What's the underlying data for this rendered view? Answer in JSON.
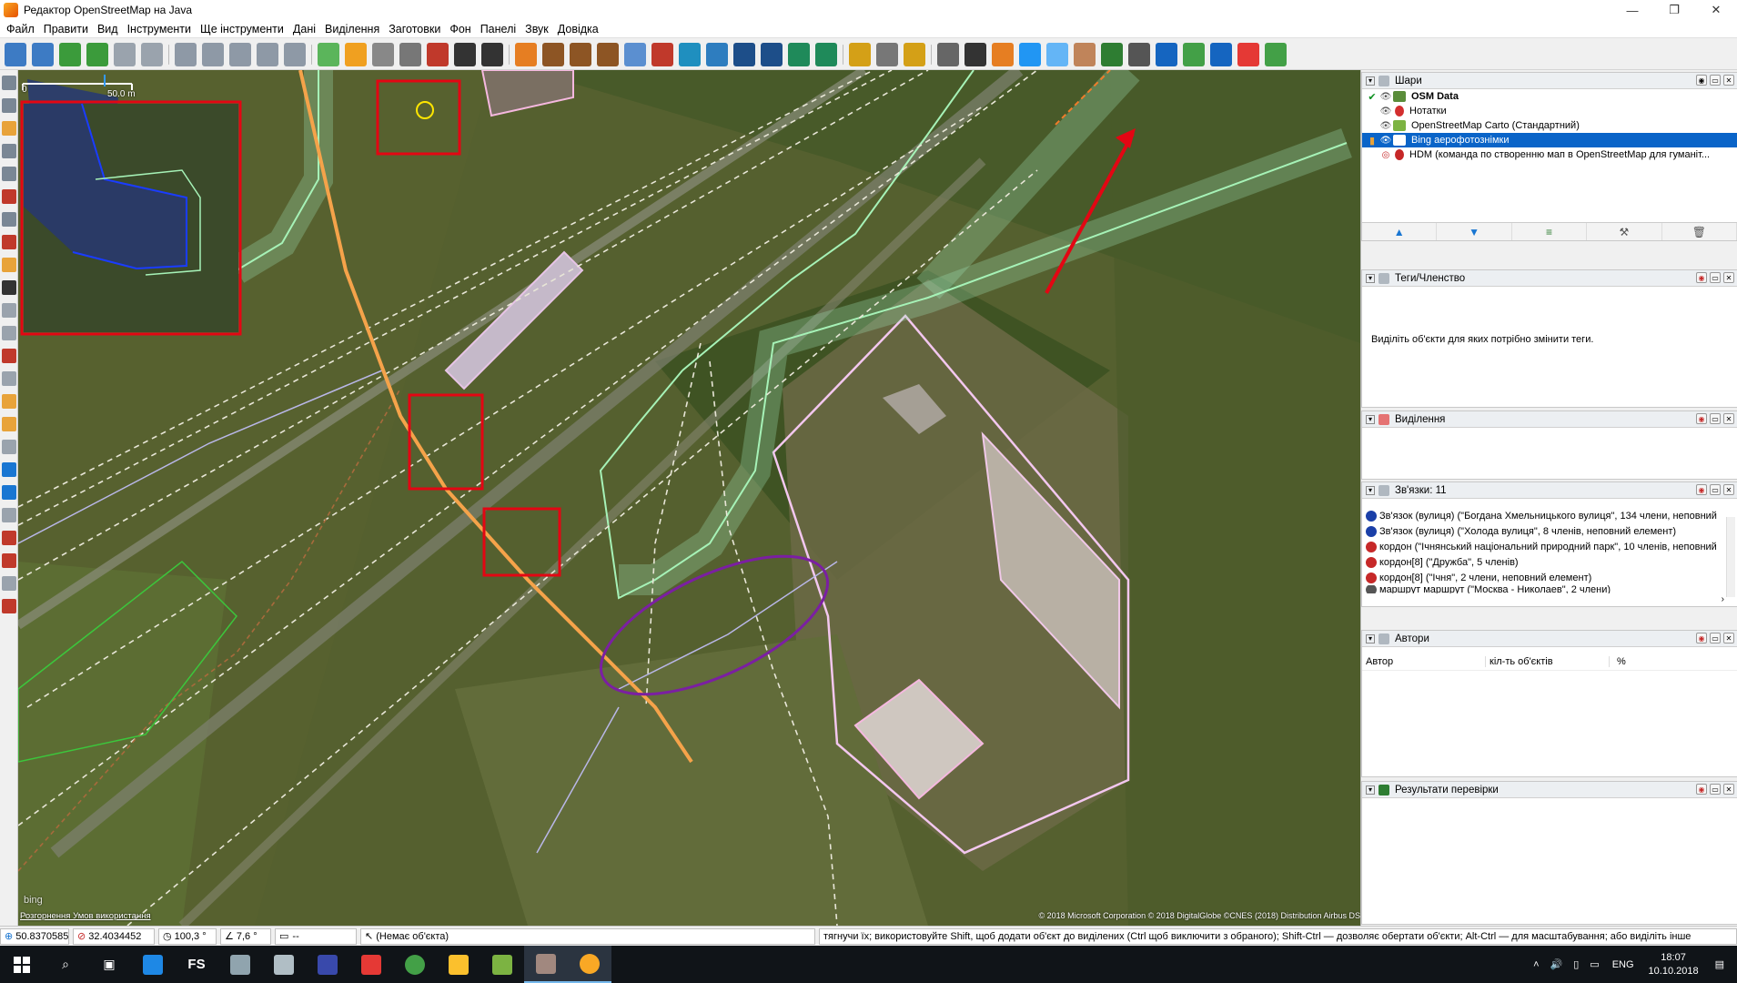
{
  "window": {
    "title": "Редактор OpenStreetMap на Java",
    "controls": [
      "—",
      "❐",
      "✕"
    ]
  },
  "menu": [
    "Файл",
    "Правити",
    "Вид",
    "Інструменти",
    "Ще інструменти",
    "Дані",
    "Виділення",
    "Заготовки",
    "Фон",
    "Панелі",
    "Звук",
    "Довідка"
  ],
  "map": {
    "scale_start": "0",
    "scale_end": "50.0 m",
    "attribution_left": "Розгорнення Умов використання",
    "attribution_right": "© 2018 Microsoft Corporation © 2018 DigitalGlobe ©CNES (2018) Distribution Airbus DS",
    "bing_logo": "bing"
  },
  "layers": {
    "title": "Шари",
    "items": [
      {
        "label": "OSM Data",
        "bold": true,
        "active": true,
        "selected": false
      },
      {
        "label": "Нотатки",
        "bold": false,
        "active": false,
        "selected": false
      },
      {
        "label": "OpenStreetMap Carto (Стандартний)",
        "bold": false,
        "active": false,
        "selected": false
      },
      {
        "label": "Bing аерофотознімки",
        "bold": false,
        "active": false,
        "selected": true
      },
      {
        "label": "HDM (команда по створенню мап в OpenStreetMap для гуманіт...",
        "bold": false,
        "active": false,
        "selected": false
      }
    ]
  },
  "tags": {
    "title": "Теги/Членство",
    "empty_text": "Виділіть об'єкти для яких потрібно змінити теги."
  },
  "selection": {
    "title": "Виділення"
  },
  "relations": {
    "title": "Зв'язки: 11",
    "items": [
      {
        "label": "Зв'язок (вулиця) (\"Богдана Хмельницького вулиця\", 134 члени, неповний",
        "color": "#1a3fa8"
      },
      {
        "label": "Зв'язок (вулиця) (\"Холода вулиця\", 8 членів, неповний елемент)",
        "color": "#1a3fa8"
      },
      {
        "label": "кордон (\"Ічнянський національний природний парк\", 10 членів, неповний",
        "color": "#c62828"
      },
      {
        "label": "кордон[8] (\"Дружба\", 5 членів)",
        "color": "#c62828"
      },
      {
        "label": "кордон[8] (\"Ічня\", 2 члени, неповний елемент)",
        "color": "#c62828"
      },
      {
        "label": "маршрут маршрут (\"Москва - Николаев\", 2 члени)",
        "color": "#555555"
      }
    ]
  },
  "authors": {
    "title": "Автори",
    "columns": [
      "Автор",
      "кіл-ть об'єктів",
      "%"
    ]
  },
  "validation": {
    "title": "Результати перевірки"
  },
  "status": {
    "lat": "50.8370585",
    "lon": "32.4034452",
    "heading": "100,3 °",
    "angle": "7,6 °",
    "distance": "--",
    "object": "(Немає об'єкта)",
    "help": "тягнучи їх; використовуйте Shift, щоб додати об'єкт до виділених (Ctrl щоб виключити з обраного); Shift-Ctrl — дозволяє обертати об'єкти; Alt-Ctrl — для масштабування; або виділіть інше"
  },
  "taskbar": {
    "fs_label": "FS",
    "lang": "ENG",
    "time": "18:07",
    "date": "10.10.2018"
  }
}
